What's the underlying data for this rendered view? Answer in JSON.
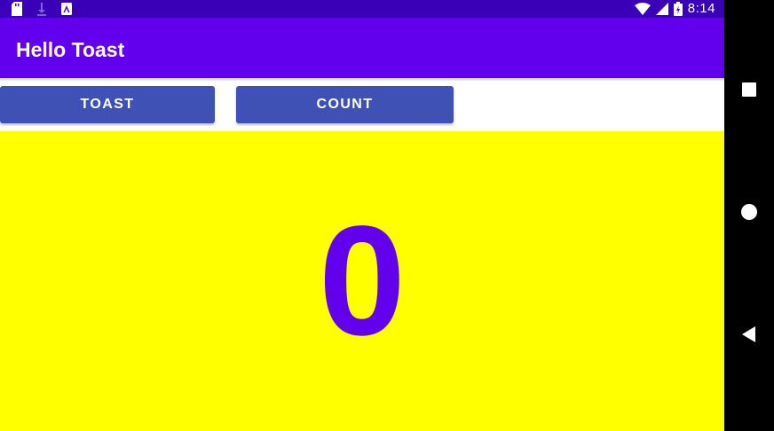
{
  "status_bar": {
    "time": "8:14",
    "left_icons": [
      "sd-card-icon",
      "download-icon",
      "accessibility-icon"
    ],
    "right_icons": [
      "wifi-icon",
      "cell-signal-icon",
      "battery-icon"
    ]
  },
  "app_bar": {
    "title": "Hello Toast"
  },
  "buttons": {
    "toast_label": "TOAST",
    "count_label": "COUNT"
  },
  "count": {
    "value": "0"
  },
  "nav_bar": {
    "icons": [
      "recents-square-icon",
      "home-circle-icon",
      "back-triangle-icon"
    ]
  },
  "colors": {
    "status_bar": "#3a00b8",
    "app_bar": "#6200ee",
    "button": "#3f51b5",
    "count_background": "#ffff00",
    "count_text": "#6200ee",
    "nav_bar": "#000000"
  }
}
